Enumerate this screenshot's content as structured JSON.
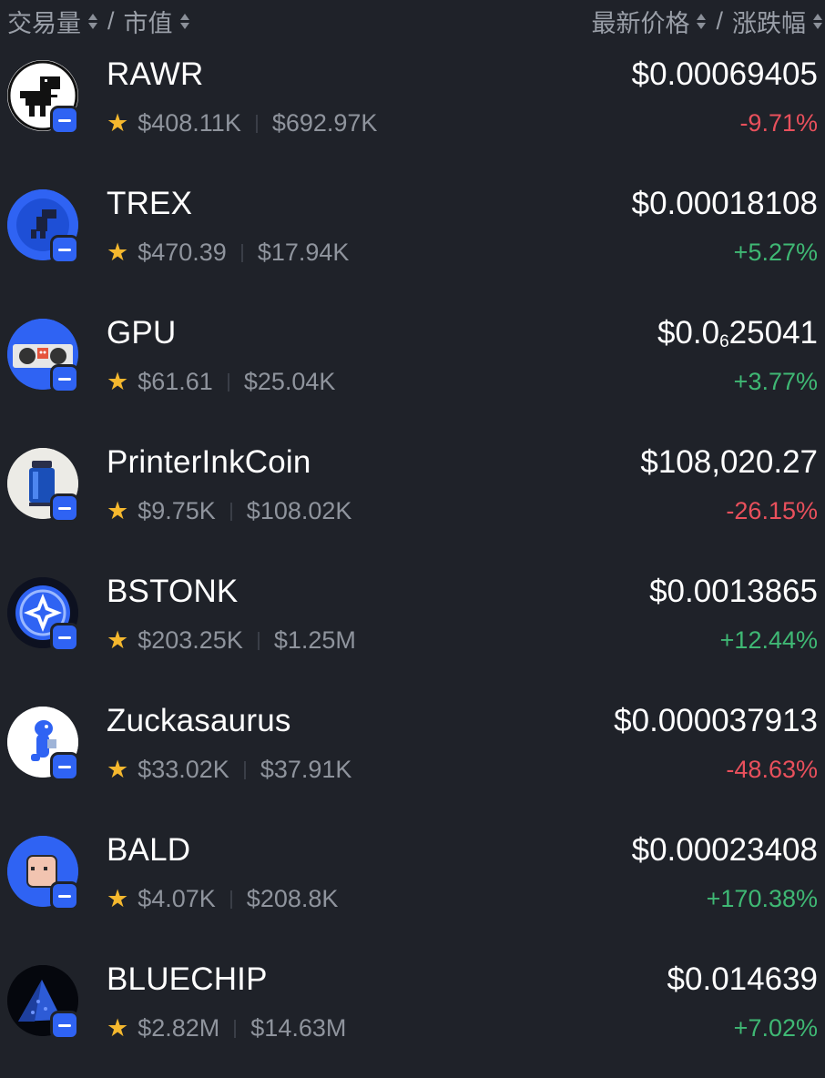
{
  "header": {
    "volume_label": "交易量",
    "market_cap_label": "市值",
    "price_label": "最新价格",
    "change_label": "涨跌幅",
    "separator": "/"
  },
  "colors": {
    "background": "#1f2229",
    "negative": "#e9505c",
    "positive": "#3fb874",
    "badge": "#2f63f3",
    "star": "#f5b82e"
  },
  "tokens": [
    {
      "name": "RAWR",
      "volume": "$408.11K",
      "market_cap": "$692.97K",
      "price": "$0.00069405",
      "change": "-9.71%",
      "direction": "neg",
      "icon": "dino-icon"
    },
    {
      "name": "TREX",
      "volume": "$470.39",
      "market_cap": "$17.94K",
      "price": "$0.00018108",
      "change": "+5.27%",
      "direction": "pos",
      "icon": "trex-icon"
    },
    {
      "name": "GPU",
      "volume": "$61.61",
      "market_cap": "$25.04K",
      "price_prefix": "$0.0",
      "price_sub": "6",
      "price_suffix": "25041",
      "change": "+3.77%",
      "direction": "pos",
      "icon": "gpu-icon"
    },
    {
      "name": "PrinterInkCoin",
      "volume": "$9.75K",
      "market_cap": "$108.02K",
      "price": "$108,020.27",
      "change": "-26.15%",
      "direction": "neg",
      "icon": "ink-cartridge-icon"
    },
    {
      "name": "BSTONK",
      "volume": "$203.25K",
      "market_cap": "$1.25M",
      "price": "$0.0013865",
      "change": "+12.44%",
      "direction": "pos",
      "icon": "diamond-star-icon"
    },
    {
      "name": "Zuckasaurus",
      "volume": "$33.02K",
      "market_cap": "$37.91K",
      "price": "$0.000037913",
      "change": "-48.63%",
      "direction": "neg",
      "icon": "blue-dino-icon"
    },
    {
      "name": "BALD",
      "volume": "$4.07K",
      "market_cap": "$208.8K",
      "price": "$0.00023408",
      "change": "+170.38%",
      "direction": "pos",
      "icon": "bald-head-icon"
    },
    {
      "name": "BLUECHIP",
      "volume": "$2.82M",
      "market_cap": "$14.63M",
      "price": "$0.014639",
      "change": "+7.02%",
      "direction": "pos",
      "icon": "blue-chip-icon"
    }
  ]
}
